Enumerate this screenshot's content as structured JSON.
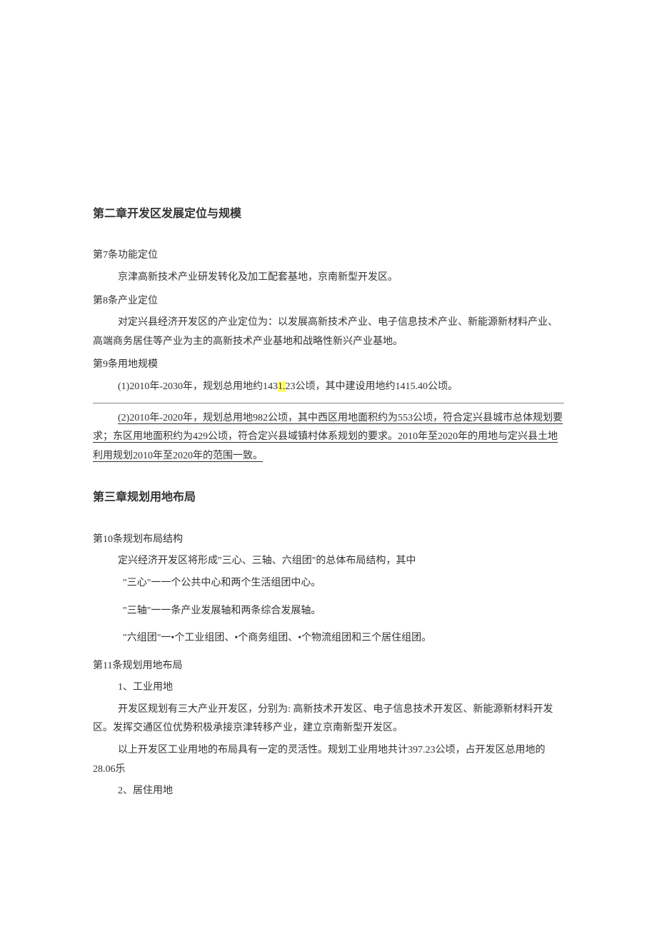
{
  "chapter2": {
    "title": "第二章开发区发展定位与规模",
    "article7": {
      "title": "第7条功能定位",
      "p1": "京津高新技术产业研发转化及加工配套基地，京南新型开发区。"
    },
    "article8": {
      "title": "第8条产业定位",
      "p1": "对定兴县经济开发区的产业定位为：以发展高新技术产业、电子信息技术产业、新能源新材料产业、高端商务居住等产业为主的高新技术产业基地和战略性新兴产业基地。"
    },
    "article9": {
      "title": "第9条用地规模",
      "p1_prefix": "(1)2010年-2030年，规划总用地约143",
      "p1_highlight": "1.",
      "p1_suffix": "23公顷，其中建设用地约1415.40公顷。",
      "p2": "(2)2010年-2020年，规划总用地982公顷，其中西区用地面积约为553公顷，符合定兴县城市总体规划要求；东区用地面积约为429公顷，符合定兴县域镇村体系规划的要求。2010年至2020年的用地与定兴县土地利用规划2010年至2020年的范围一致。"
    }
  },
  "chapter3": {
    "title": "第三章规划用地布局",
    "article10": {
      "title": "第10条规划布局结构",
      "p1": "定兴经济开发区将形成\"三心、三轴、六组团\"的总体布局结构，其中",
      "p2": "\"三心\"一一个公共中心和两个生活组团中心。",
      "p3": "\"三轴\"一一条产业发展轴和两条综合发展轴。",
      "p4": "\"六组团\"一•个工业组团、•个商务组团、•个物流组团和三个居住组团。"
    },
    "article11": {
      "title": "第11条规划用地布局",
      "p1": "1、工业用地",
      "p2": "开发区规划有三大产业开发区，分别为: 高新技术开发区、电子信息技术开发区、新能源新材料开发区。发挥交通区位优势积极承接京津转移产业，建立京南新型开发区。",
      "p3": "以上开发区工业用地的布局具有一定的灵活性。规划工业用地共计397.23公顷，占开发区总用地的28.06乐",
      "p4": "2、居住用地"
    }
  }
}
